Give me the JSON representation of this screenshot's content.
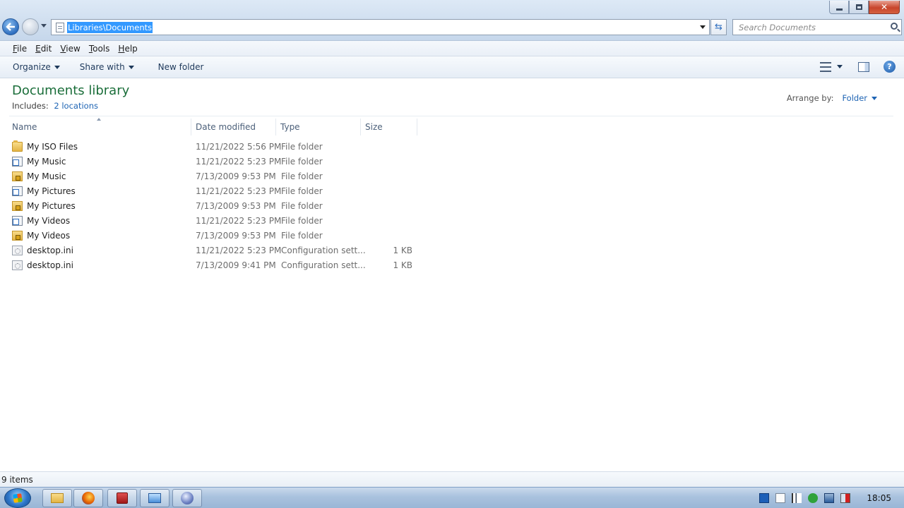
{
  "window": {
    "address_path": "Libraries\\Documents",
    "search_placeholder": "Search Documents"
  },
  "menu": [
    "File",
    "Edit",
    "View",
    "Tools",
    "Help"
  ],
  "menu_underline": [
    "F",
    "E",
    "V",
    "T",
    "H"
  ],
  "toolbar": {
    "organize": "Organize",
    "share_with": "Share with",
    "new_folder": "New folder"
  },
  "library": {
    "title": "Documents library",
    "includes_label": "Includes:",
    "includes_link": "2 locations",
    "arrange_label": "Arrange by:",
    "arrange_value": "Folder"
  },
  "columns": {
    "name": "Name",
    "date": "Date modified",
    "type": "Type",
    "size": "Size"
  },
  "files": [
    {
      "name": "My ISO Files",
      "date": "11/21/2022 5:56 PM",
      "type": "File folder",
      "size": "",
      "icon": "folder-icon"
    },
    {
      "name": "My Music",
      "date": "11/21/2022 5:23 PM",
      "type": "File folder",
      "size": "",
      "icon": "shortcut-icon"
    },
    {
      "name": "My Music",
      "date": "7/13/2009 9:53 PM",
      "type": "File folder",
      "size": "",
      "icon": "locked-folder-icon"
    },
    {
      "name": "My Pictures",
      "date": "11/21/2022 5:23 PM",
      "type": "File folder",
      "size": "",
      "icon": "shortcut-icon"
    },
    {
      "name": "My Pictures",
      "date": "7/13/2009 9:53 PM",
      "type": "File folder",
      "size": "",
      "icon": "locked-folder-icon"
    },
    {
      "name": "My Videos",
      "date": "11/21/2022 5:23 PM",
      "type": "File folder",
      "size": "",
      "icon": "shortcut-icon"
    },
    {
      "name": "My Videos",
      "date": "7/13/2009 9:53 PM",
      "type": "File folder",
      "size": "",
      "icon": "locked-folder-icon"
    },
    {
      "name": "desktop.ini",
      "date": "11/21/2022 5:23 PM",
      "type": "Configuration sett...",
      "size": "1 KB",
      "icon": "ini-file-icon"
    },
    {
      "name": "desktop.ini",
      "date": "7/13/2009 9:41 PM",
      "type": "Configuration sett...",
      "size": "1 KB",
      "icon": "ini-file-icon"
    }
  ],
  "status": {
    "item_count": "9 items"
  },
  "taskbar": {
    "clock": "18:05"
  }
}
